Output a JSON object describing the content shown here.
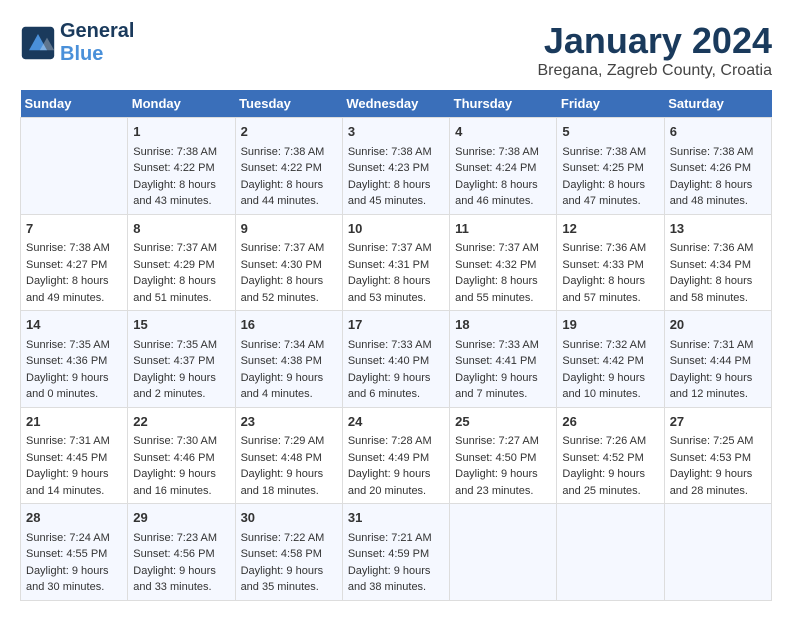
{
  "header": {
    "logo_line1": "General",
    "logo_line2": "Blue",
    "month_title": "January 2024",
    "location": "Bregana, Zagreb County, Croatia"
  },
  "days_header": [
    "Sunday",
    "Monday",
    "Tuesday",
    "Wednesday",
    "Thursday",
    "Friday",
    "Saturday"
  ],
  "weeks": [
    [
      {
        "day": "",
        "sunrise": "",
        "sunset": "",
        "daylight": "",
        "empty": true
      },
      {
        "day": "1",
        "sunrise": "Sunrise: 7:38 AM",
        "sunset": "Sunset: 4:22 PM",
        "daylight": "Daylight: 8 hours and 43 minutes."
      },
      {
        "day": "2",
        "sunrise": "Sunrise: 7:38 AM",
        "sunset": "Sunset: 4:22 PM",
        "daylight": "Daylight: 8 hours and 44 minutes."
      },
      {
        "day": "3",
        "sunrise": "Sunrise: 7:38 AM",
        "sunset": "Sunset: 4:23 PM",
        "daylight": "Daylight: 8 hours and 45 minutes."
      },
      {
        "day": "4",
        "sunrise": "Sunrise: 7:38 AM",
        "sunset": "Sunset: 4:24 PM",
        "daylight": "Daylight: 8 hours and 46 minutes."
      },
      {
        "day": "5",
        "sunrise": "Sunrise: 7:38 AM",
        "sunset": "Sunset: 4:25 PM",
        "daylight": "Daylight: 8 hours and 47 minutes."
      },
      {
        "day": "6",
        "sunrise": "Sunrise: 7:38 AM",
        "sunset": "Sunset: 4:26 PM",
        "daylight": "Daylight: 8 hours and 48 minutes."
      }
    ],
    [
      {
        "day": "7",
        "sunrise": "Sunrise: 7:38 AM",
        "sunset": "Sunset: 4:27 PM",
        "daylight": "Daylight: 8 hours and 49 minutes."
      },
      {
        "day": "8",
        "sunrise": "Sunrise: 7:37 AM",
        "sunset": "Sunset: 4:29 PM",
        "daylight": "Daylight: 8 hours and 51 minutes."
      },
      {
        "day": "9",
        "sunrise": "Sunrise: 7:37 AM",
        "sunset": "Sunset: 4:30 PM",
        "daylight": "Daylight: 8 hours and 52 minutes."
      },
      {
        "day": "10",
        "sunrise": "Sunrise: 7:37 AM",
        "sunset": "Sunset: 4:31 PM",
        "daylight": "Daylight: 8 hours and 53 minutes."
      },
      {
        "day": "11",
        "sunrise": "Sunrise: 7:37 AM",
        "sunset": "Sunset: 4:32 PM",
        "daylight": "Daylight: 8 hours and 55 minutes."
      },
      {
        "day": "12",
        "sunrise": "Sunrise: 7:36 AM",
        "sunset": "Sunset: 4:33 PM",
        "daylight": "Daylight: 8 hours and 57 minutes."
      },
      {
        "day": "13",
        "sunrise": "Sunrise: 7:36 AM",
        "sunset": "Sunset: 4:34 PM",
        "daylight": "Daylight: 8 hours and 58 minutes."
      }
    ],
    [
      {
        "day": "14",
        "sunrise": "Sunrise: 7:35 AM",
        "sunset": "Sunset: 4:36 PM",
        "daylight": "Daylight: 9 hours and 0 minutes."
      },
      {
        "day": "15",
        "sunrise": "Sunrise: 7:35 AM",
        "sunset": "Sunset: 4:37 PM",
        "daylight": "Daylight: 9 hours and 2 minutes."
      },
      {
        "day": "16",
        "sunrise": "Sunrise: 7:34 AM",
        "sunset": "Sunset: 4:38 PM",
        "daylight": "Daylight: 9 hours and 4 minutes."
      },
      {
        "day": "17",
        "sunrise": "Sunrise: 7:33 AM",
        "sunset": "Sunset: 4:40 PM",
        "daylight": "Daylight: 9 hours and 6 minutes."
      },
      {
        "day": "18",
        "sunrise": "Sunrise: 7:33 AM",
        "sunset": "Sunset: 4:41 PM",
        "daylight": "Daylight: 9 hours and 7 minutes."
      },
      {
        "day": "19",
        "sunrise": "Sunrise: 7:32 AM",
        "sunset": "Sunset: 4:42 PM",
        "daylight": "Daylight: 9 hours and 10 minutes."
      },
      {
        "day": "20",
        "sunrise": "Sunrise: 7:31 AM",
        "sunset": "Sunset: 4:44 PM",
        "daylight": "Daylight: 9 hours and 12 minutes."
      }
    ],
    [
      {
        "day": "21",
        "sunrise": "Sunrise: 7:31 AM",
        "sunset": "Sunset: 4:45 PM",
        "daylight": "Daylight: 9 hours and 14 minutes."
      },
      {
        "day": "22",
        "sunrise": "Sunrise: 7:30 AM",
        "sunset": "Sunset: 4:46 PM",
        "daylight": "Daylight: 9 hours and 16 minutes."
      },
      {
        "day": "23",
        "sunrise": "Sunrise: 7:29 AM",
        "sunset": "Sunset: 4:48 PM",
        "daylight": "Daylight: 9 hours and 18 minutes."
      },
      {
        "day": "24",
        "sunrise": "Sunrise: 7:28 AM",
        "sunset": "Sunset: 4:49 PM",
        "daylight": "Daylight: 9 hours and 20 minutes."
      },
      {
        "day": "25",
        "sunrise": "Sunrise: 7:27 AM",
        "sunset": "Sunset: 4:50 PM",
        "daylight": "Daylight: 9 hours and 23 minutes."
      },
      {
        "day": "26",
        "sunrise": "Sunrise: 7:26 AM",
        "sunset": "Sunset: 4:52 PM",
        "daylight": "Daylight: 9 hours and 25 minutes."
      },
      {
        "day": "27",
        "sunrise": "Sunrise: 7:25 AM",
        "sunset": "Sunset: 4:53 PM",
        "daylight": "Daylight: 9 hours and 28 minutes."
      }
    ],
    [
      {
        "day": "28",
        "sunrise": "Sunrise: 7:24 AM",
        "sunset": "Sunset: 4:55 PM",
        "daylight": "Daylight: 9 hours and 30 minutes."
      },
      {
        "day": "29",
        "sunrise": "Sunrise: 7:23 AM",
        "sunset": "Sunset: 4:56 PM",
        "daylight": "Daylight: 9 hours and 33 minutes."
      },
      {
        "day": "30",
        "sunrise": "Sunrise: 7:22 AM",
        "sunset": "Sunset: 4:58 PM",
        "daylight": "Daylight: 9 hours and 35 minutes."
      },
      {
        "day": "31",
        "sunrise": "Sunrise: 7:21 AM",
        "sunset": "Sunset: 4:59 PM",
        "daylight": "Daylight: 9 hours and 38 minutes."
      },
      {
        "day": "",
        "sunrise": "",
        "sunset": "",
        "daylight": "",
        "empty": true
      },
      {
        "day": "",
        "sunrise": "",
        "sunset": "",
        "daylight": "",
        "empty": true
      },
      {
        "day": "",
        "sunrise": "",
        "sunset": "",
        "daylight": "",
        "empty": true
      }
    ]
  ]
}
